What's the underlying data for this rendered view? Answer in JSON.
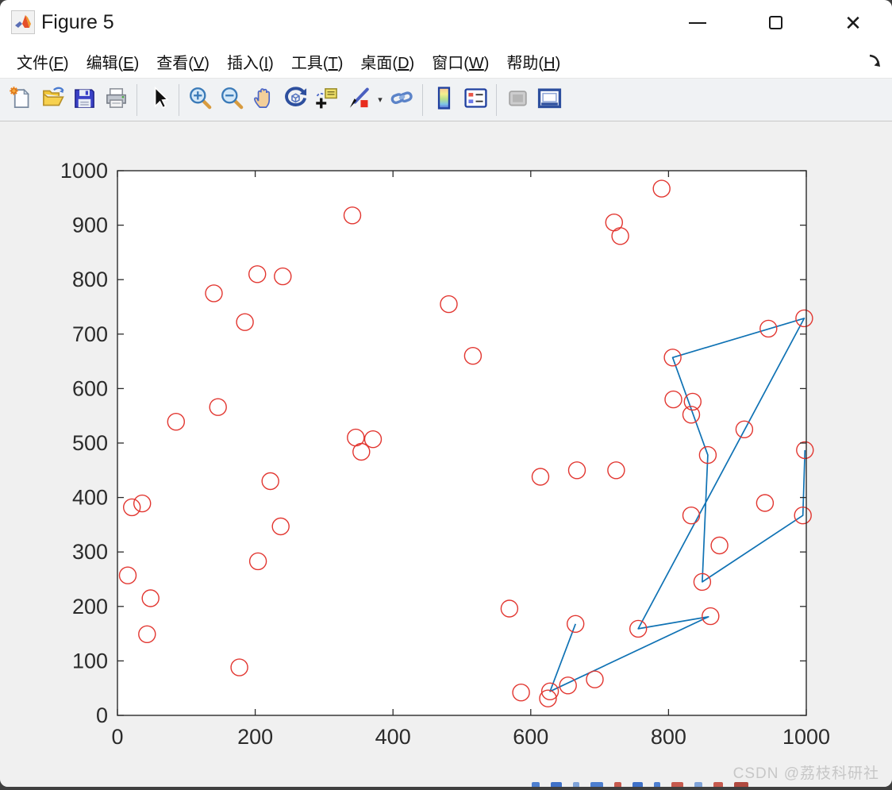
{
  "window": {
    "title": "Figure 5",
    "controls": [
      {
        "name": "minimize-button",
        "glyph": "minimize"
      },
      {
        "name": "maximize-button",
        "glyph": "maximize"
      },
      {
        "name": "close-button",
        "glyph": "close",
        "label": "✕"
      }
    ]
  },
  "menu_bar": {
    "items": [
      {
        "text": "文件",
        "hotkey": "F"
      },
      {
        "text": "编辑",
        "hotkey": "E"
      },
      {
        "text": "查看",
        "hotkey": "V"
      },
      {
        "text": "插入",
        "hotkey": "I"
      },
      {
        "text": "工具",
        "hotkey": "T"
      },
      {
        "text": "桌面",
        "hotkey": "D"
      },
      {
        "text": "窗口",
        "hotkey": "W"
      },
      {
        "text": "帮助",
        "hotkey": "H"
      }
    ],
    "dock_arrow_icon": "dock-arrow-icon"
  },
  "toolbar": {
    "buttons": [
      {
        "icon": "new-figure-icon",
        "enabled": true,
        "group_end": false
      },
      {
        "icon": "open-file-icon",
        "enabled": true,
        "group_end": false
      },
      {
        "icon": "save-icon",
        "enabled": true,
        "group_end": false
      },
      {
        "icon": "print-icon",
        "enabled": true,
        "group_end": true
      },
      {
        "icon": "pointer-arrow-icon",
        "enabled": true,
        "group_end": true
      },
      {
        "icon": "zoom-in-icon",
        "enabled": true,
        "group_end": false
      },
      {
        "icon": "zoom-out-icon",
        "enabled": true,
        "group_end": false
      },
      {
        "icon": "pan-hand-icon",
        "enabled": true,
        "group_end": false
      },
      {
        "icon": "rotate-3d-icon",
        "enabled": true,
        "group_end": false
      },
      {
        "icon": "data-cursor-icon",
        "enabled": true,
        "group_end": false
      },
      {
        "icon": "brush-icon",
        "enabled": true,
        "group_end": false,
        "dropdown": true
      },
      {
        "icon": "link-plot-icon",
        "enabled": true,
        "group_end": true
      },
      {
        "icon": "colorbar-icon",
        "enabled": true,
        "group_end": false
      },
      {
        "icon": "legend-icon",
        "enabled": true,
        "group_end": true
      },
      {
        "icon": "disabled-panel-icon",
        "enabled": false,
        "group_end": false
      },
      {
        "icon": "dock-figure-icon",
        "enabled": true,
        "group_end": false
      }
    ],
    "dropdown_caret": "▾"
  },
  "chart_data": {
    "type": "scatter",
    "title": "",
    "xlabel": "",
    "ylabel": "",
    "xlim": [
      0,
      1000
    ],
    "ylim": [
      0,
      1000
    ],
    "xticks": [
      0,
      200,
      400,
      600,
      800,
      1000
    ],
    "yticks": [
      0,
      100,
      200,
      300,
      400,
      500,
      600,
      700,
      800,
      900,
      1000
    ],
    "grid": false,
    "box": true,
    "legend_position": "none",
    "marker": "open-circle",
    "marker_color": "#e23630",
    "line_color": "#0f72b4",
    "points": [
      [
        341,
        918
      ],
      [
        790,
        967
      ],
      [
        721,
        905
      ],
      [
        730,
        880
      ],
      [
        203,
        810
      ],
      [
        240,
        806
      ],
      [
        140,
        775
      ],
      [
        481,
        755
      ],
      [
        185,
        722
      ],
      [
        997,
        729
      ],
      [
        945,
        710
      ],
      [
        516,
        660
      ],
      [
        806,
        657
      ],
      [
        807,
        580
      ],
      [
        835,
        576
      ],
      [
        833,
        552
      ],
      [
        146,
        566
      ],
      [
        85,
        539
      ],
      [
        346,
        510
      ],
      [
        371,
        507
      ],
      [
        354,
        484
      ],
      [
        910,
        525
      ],
      [
        998,
        487
      ],
      [
        940,
        390
      ],
      [
        995,
        367
      ],
      [
        874,
        312
      ],
      [
        849,
        245
      ],
      [
        614,
        438
      ],
      [
        667,
        450
      ],
      [
        724,
        450
      ],
      [
        222,
        430
      ],
      [
        21,
        382
      ],
      [
        36,
        389
      ],
      [
        237,
        347
      ],
      [
        204,
        283
      ],
      [
        15,
        257
      ],
      [
        48,
        215
      ],
      [
        43,
        149
      ],
      [
        177,
        88
      ],
      [
        569,
        196
      ],
      [
        586,
        42
      ],
      [
        628,
        44
      ],
      [
        625,
        31
      ],
      [
        654,
        55
      ],
      [
        693,
        66
      ],
      [
        665,
        168
      ],
      [
        756,
        159
      ],
      [
        861,
        182
      ],
      [
        833,
        367
      ],
      [
        857,
        478
      ]
    ],
    "route": [
      [
        665,
        168
      ],
      [
        628,
        44
      ],
      [
        858,
        181
      ],
      [
        756,
        159
      ],
      [
        997,
        729
      ],
      [
        806,
        657
      ],
      [
        857,
        478
      ],
      [
        849,
        245
      ],
      [
        995,
        367
      ],
      [
        998,
        487
      ]
    ]
  },
  "watermark": {
    "text": "CSDN @荔枝科研社",
    "color": "#c7c7c7"
  }
}
